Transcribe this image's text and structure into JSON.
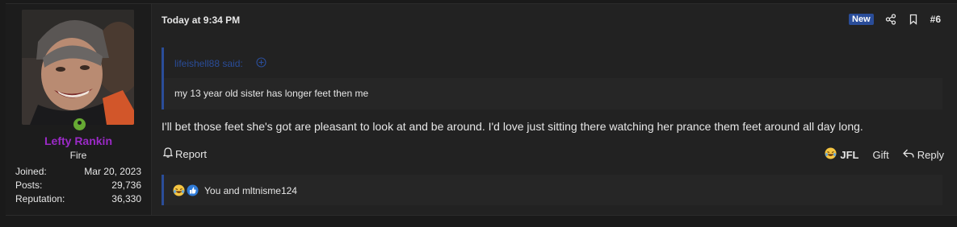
{
  "user": {
    "name": "Lefty Rankin",
    "title": "Fire",
    "stats": [
      {
        "label": "Joined:",
        "value": "Mar 20, 2023"
      },
      {
        "label": "Posts:",
        "value": "29,736"
      },
      {
        "label": "Reputation:",
        "value": "36,330"
      }
    ],
    "name_color": "#9b2ac7",
    "online_color": "#66a933"
  },
  "post": {
    "date": "Today at 9:34 PM",
    "badge": "New",
    "number": "#6",
    "quote": {
      "author": "lifeishell88 said:",
      "text": "my 13 year old sister has longer feet then me"
    },
    "message": "I'll bet those feet she's got are pleasant to look at and be around. I'd love just sitting there watching her prance them feet around all day long."
  },
  "actions": {
    "report": "Report",
    "jfl": "JFL",
    "gift": "Gift",
    "reply": "Reply"
  },
  "reactions": {
    "text": "You and mltnisme124",
    "icons": [
      "laughing-crying-emoji-icon",
      "thumbs-up-icon"
    ]
  },
  "colors": {
    "accent": "#2a4d99",
    "background": "#1a1a1a",
    "panel": "#222222"
  }
}
